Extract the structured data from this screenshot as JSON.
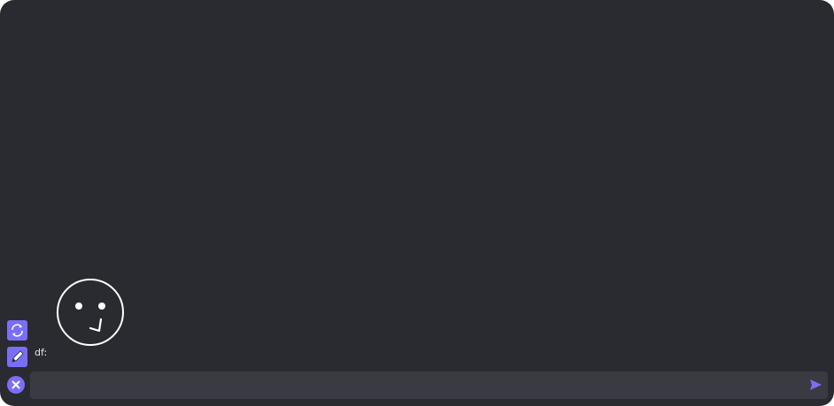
{
  "conversation": {
    "speaker_label": "df:"
  },
  "avatar": {
    "icon": "face-thinking-icon",
    "stroke_color": "#ffffff"
  },
  "sidebar": {
    "refresh_icon": "refresh-icon",
    "edit_icon": "pencil-icon"
  },
  "composer": {
    "input_value": "",
    "input_placeholder": "",
    "cancel_icon": "close-icon",
    "send_icon": "send-icon"
  },
  "colors": {
    "background": "#2a2b30",
    "accent": "#7b6ef6",
    "input_background": "#3a3b42",
    "text": "#e6e6e6"
  }
}
